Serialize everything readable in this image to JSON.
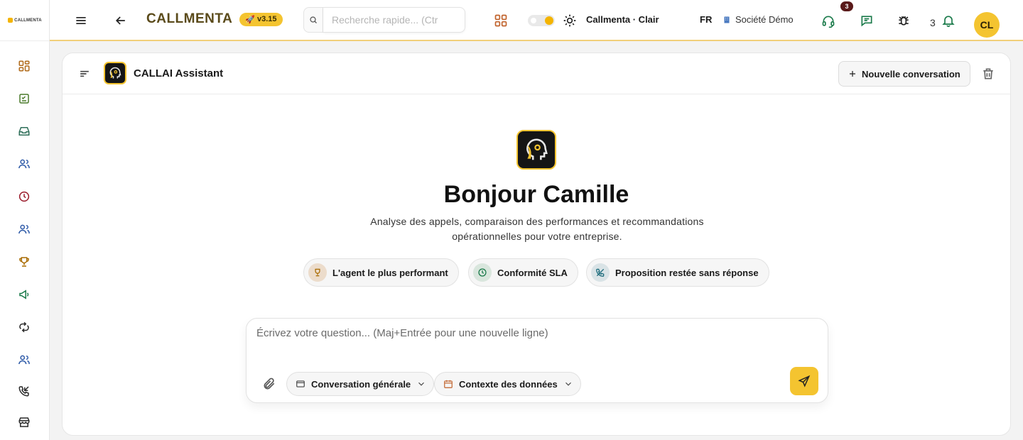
{
  "sidebar": {
    "logo_text": "CALLMENTA",
    "items": [
      {
        "icon": "dashboard-icon",
        "color": "#b06a1a"
      },
      {
        "icon": "calendar-check-icon",
        "color": "#4a7a2a"
      },
      {
        "icon": "inbox-icon",
        "color": "#2f6f5a"
      },
      {
        "icon": "users-icon",
        "color": "#2e5aa8"
      },
      {
        "icon": "clock-icon",
        "color": "#9a1a2a"
      },
      {
        "icon": "team-icon",
        "color": "#2e5aa8"
      },
      {
        "icon": "trophy-icon",
        "color": "#a86a00"
      },
      {
        "icon": "megaphone-icon",
        "color": "#1a7a4a"
      },
      {
        "icon": "sync-icon",
        "color": "#2a2a2a"
      },
      {
        "icon": "group-icon",
        "color": "#2e5aa8"
      },
      {
        "icon": "incoming-call-icon",
        "color": "#2a2a2a"
      },
      {
        "icon": "store-icon",
        "color": "#2a2a2a"
      }
    ]
  },
  "topbar": {
    "brand": "CALLMENTA",
    "version": "v3.15",
    "search_placeholder": "Recherche rapide... (Ctr",
    "theme_label": "Callmenta · Clair",
    "language": "FR",
    "company": "Société Démo",
    "support_badge": "3",
    "notification_count": "3",
    "avatar_initials": "CL"
  },
  "assistant": {
    "name": "CALLAI Assistant",
    "new_conversation": "Nouvelle conversation",
    "greeting": "Bonjour Camille",
    "subtitle": "Analyse des appels, comparaison des performances et recommandations opérationnelles pour votre entreprise.",
    "chips": [
      {
        "label": "L'agent le plus performant",
        "icon": "trophy-icon"
      },
      {
        "label": "Conformité SLA",
        "icon": "clock-icon"
      },
      {
        "label": "Proposition restée sans réponse",
        "icon": "missed-call-icon"
      }
    ],
    "composer_placeholder": "Écrivez votre question... (Maj+Entrée pour une nouvelle ligne)",
    "mode_select": "Conversation générale",
    "context_select": "Contexte des données"
  },
  "colors": {
    "accent": "#f4c430",
    "brand_text": "#5a4a1a"
  }
}
